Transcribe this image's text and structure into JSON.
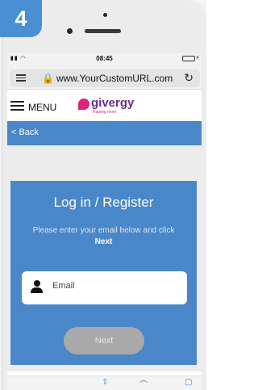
{
  "step": {
    "number": "4"
  },
  "status_bar": {
    "signal": "▮▮ ◠",
    "time": "08:45",
    "charge": "⚡"
  },
  "browser": {
    "url": "www.YourCustomURL.com",
    "lock_glyph": "🔒",
    "reload_glyph": "↻"
  },
  "header": {
    "menu_label": "MENU",
    "logo_name": "givergy",
    "logo_tagline": "Raising more"
  },
  "nav": {
    "back_label": "< Back"
  },
  "login": {
    "title": "Log in / Register",
    "instructions": "Please enter your email below and click",
    "instructions_emphasis": "Next",
    "email_placeholder": "Email",
    "next_button": "Next"
  },
  "toolbar": {
    "share_glyph": "⇧",
    "bookmarks_glyph": "⌒",
    "tabs_glyph": "▢"
  },
  "colors": {
    "accent_blue": "#4a87c9",
    "badge_blue": "#4a8fd4",
    "brand_purple": "#6a2c91",
    "brand_pink": "#e0227a",
    "button_disabled": "#a9a9a9"
  }
}
